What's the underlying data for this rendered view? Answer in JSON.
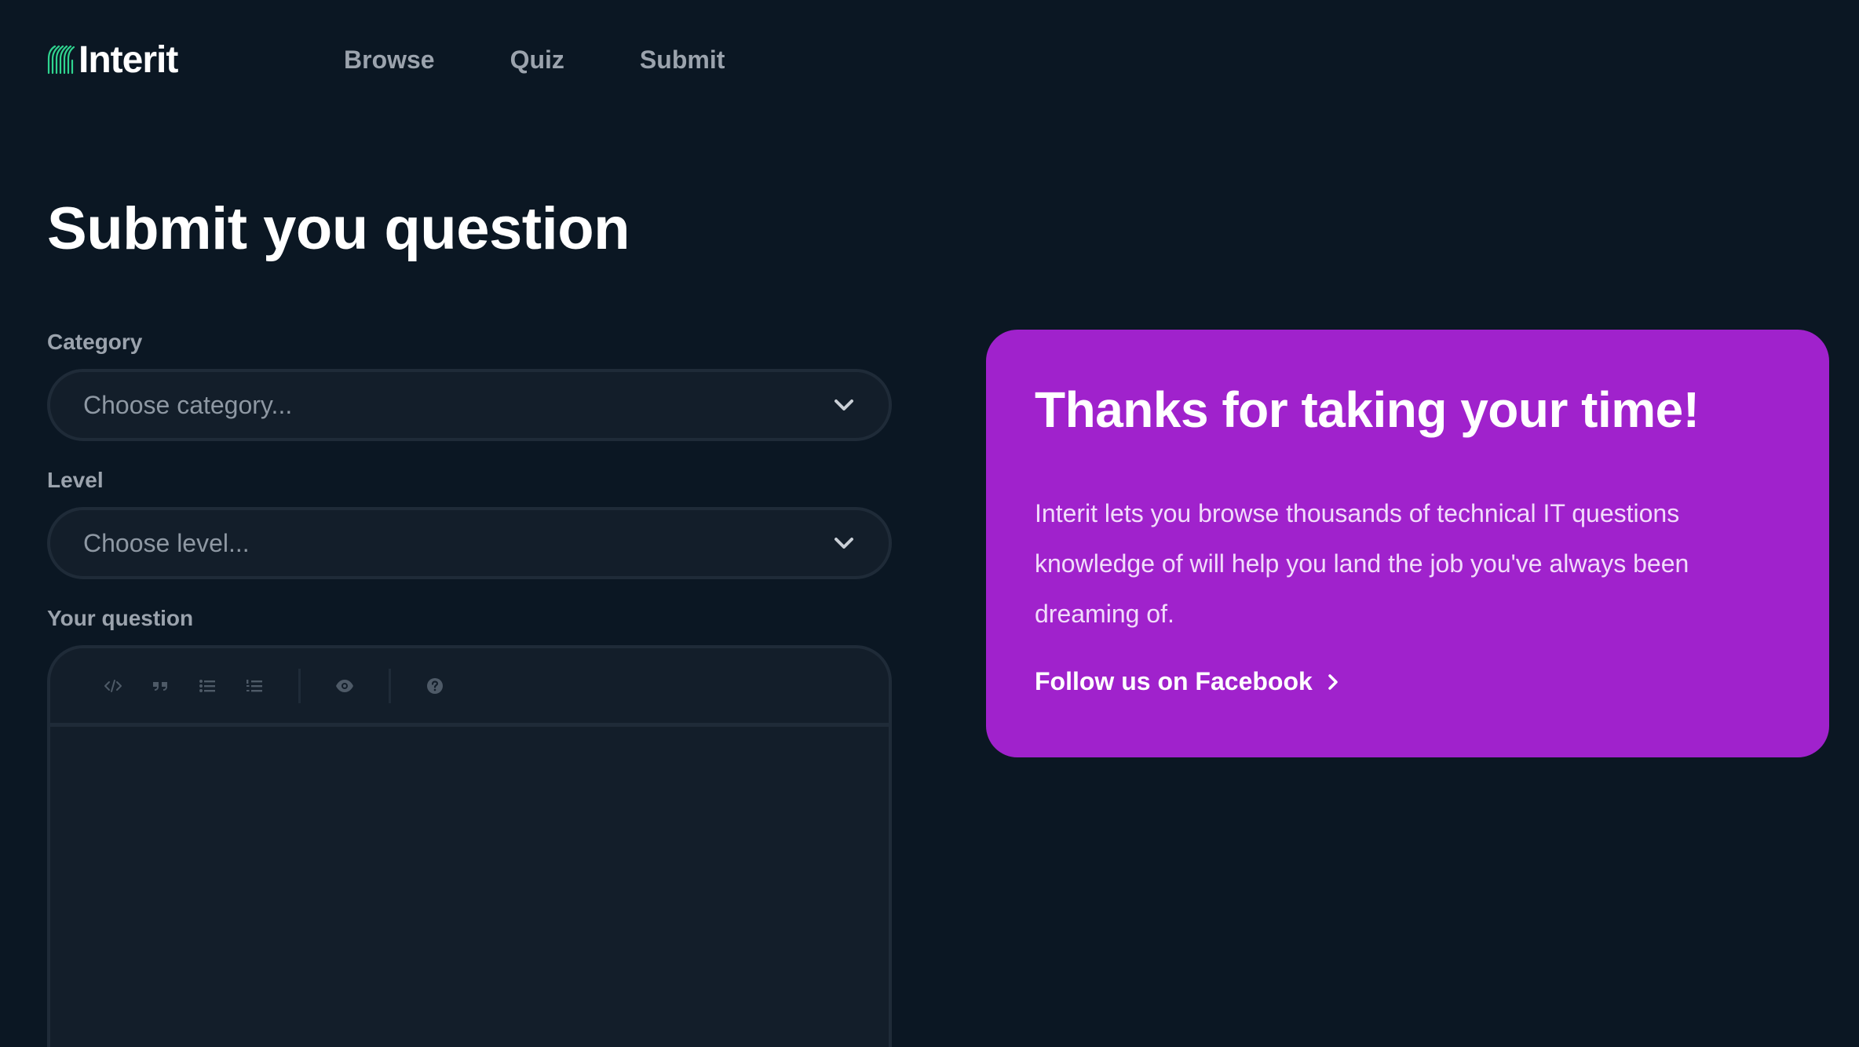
{
  "brand": {
    "name": "Interit",
    "accent": "#2fd48f"
  },
  "nav": {
    "items": [
      "Browse",
      "Quiz",
      "Submit"
    ]
  },
  "page": {
    "title": "Submit you question"
  },
  "form": {
    "category": {
      "label": "Category",
      "placeholder": "Choose category..."
    },
    "level": {
      "label": "Level",
      "placeholder": "Choose level..."
    },
    "question": {
      "label": "Your question",
      "toolbar": [
        "code-icon",
        "quote-icon",
        "bullet-list-icon",
        "numbered-list-icon",
        "preview-eye-icon",
        "help-icon"
      ]
    }
  },
  "card": {
    "title": "Thanks for taking your time!",
    "body": "Interit lets you browse thousands of technical IT questions knowledge of will help you land the job you've always been dreaming of.",
    "link_label": "Follow us on Facebook",
    "background": "#a022cc"
  },
  "colors": {
    "background": "#0b1723",
    "field": "#131e2a",
    "border": "#1f2b38",
    "muted": "#9ba3ad"
  }
}
